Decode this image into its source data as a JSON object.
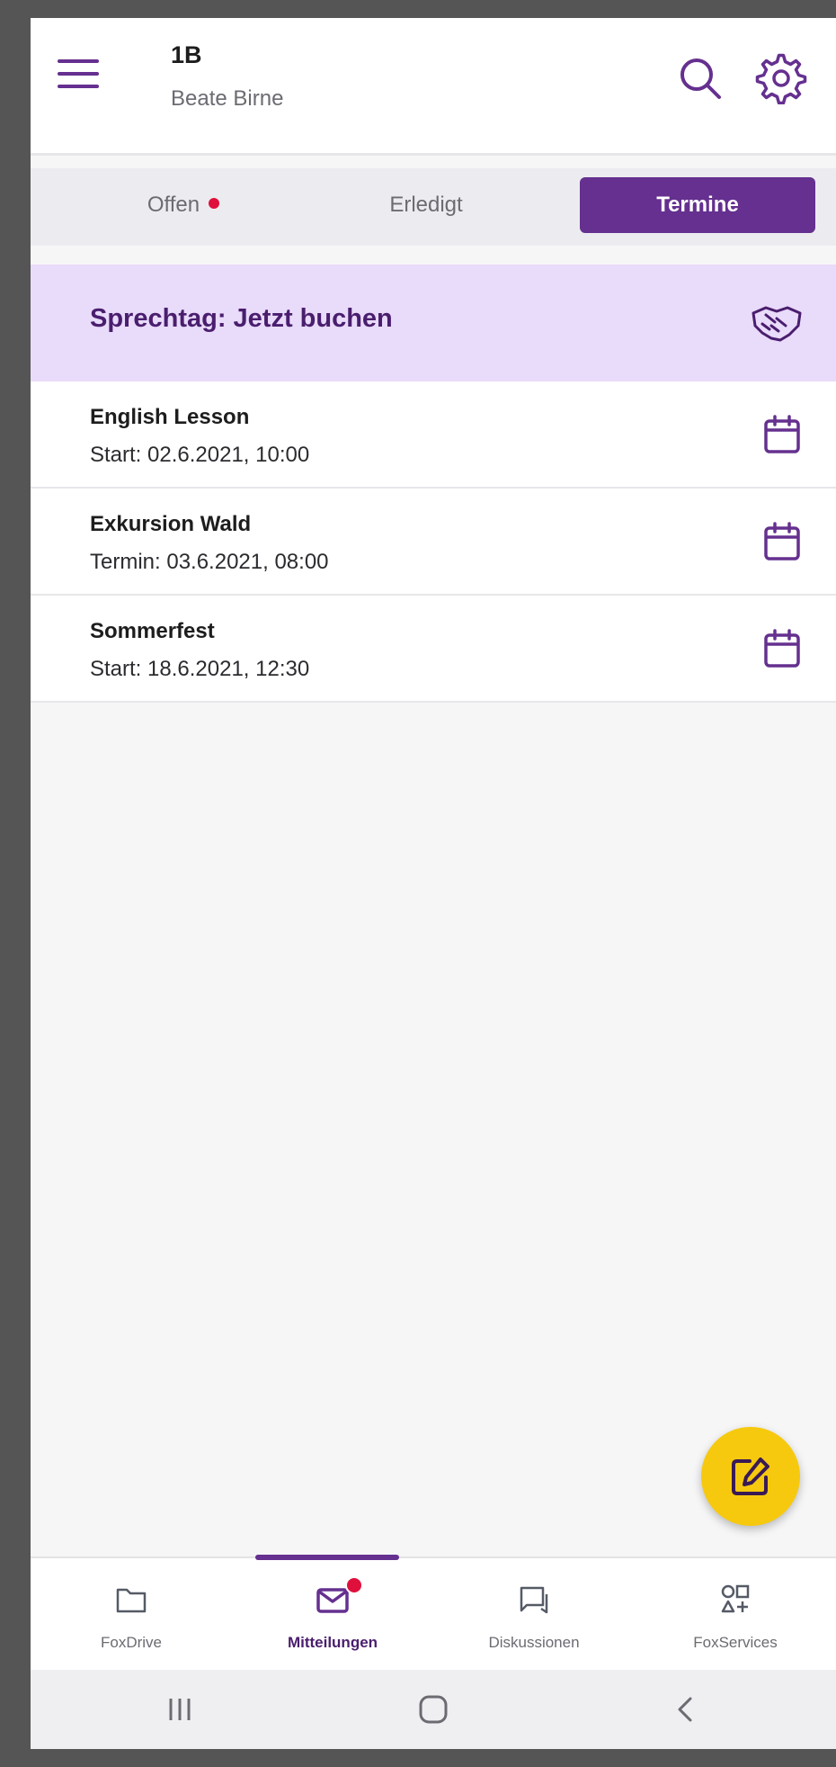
{
  "header": {
    "title": "1B",
    "subtitle": "Beate Birne"
  },
  "tabs": [
    {
      "label": "Offen",
      "has_dot": true
    },
    {
      "label": "Erledigt"
    },
    {
      "label": "Termine",
      "active": true
    }
  ],
  "banner": {
    "text": "Sprechtag: Jetzt buchen",
    "icon": "handshake-icon"
  },
  "events": [
    {
      "title": "English Lesson",
      "subtitle": "Start: 02.6.2021, 10:00",
      "icon": "calendar-icon"
    },
    {
      "title": "Exkursion Wald",
      "subtitle": "Termin: 03.6.2021, 08:00",
      "icon": "calendar-icon"
    },
    {
      "title": "Sommerfest",
      "subtitle": "Start: 18.6.2021, 12:30",
      "icon": "calendar-icon"
    }
  ],
  "bottom_nav": [
    {
      "label": "FoxDrive",
      "icon": "folder-icon"
    },
    {
      "label": "Mitteilungen",
      "icon": "mail-icon",
      "active": true,
      "badge": true
    },
    {
      "label": "Diskussionen",
      "icon": "chat-icon"
    },
    {
      "label": "FoxServices",
      "icon": "services-icon"
    }
  ],
  "colors": {
    "accent": "#65308f",
    "banner_bg": "#e9dbfa",
    "fab": "#f6c90e",
    "badge": "#e0103c"
  }
}
